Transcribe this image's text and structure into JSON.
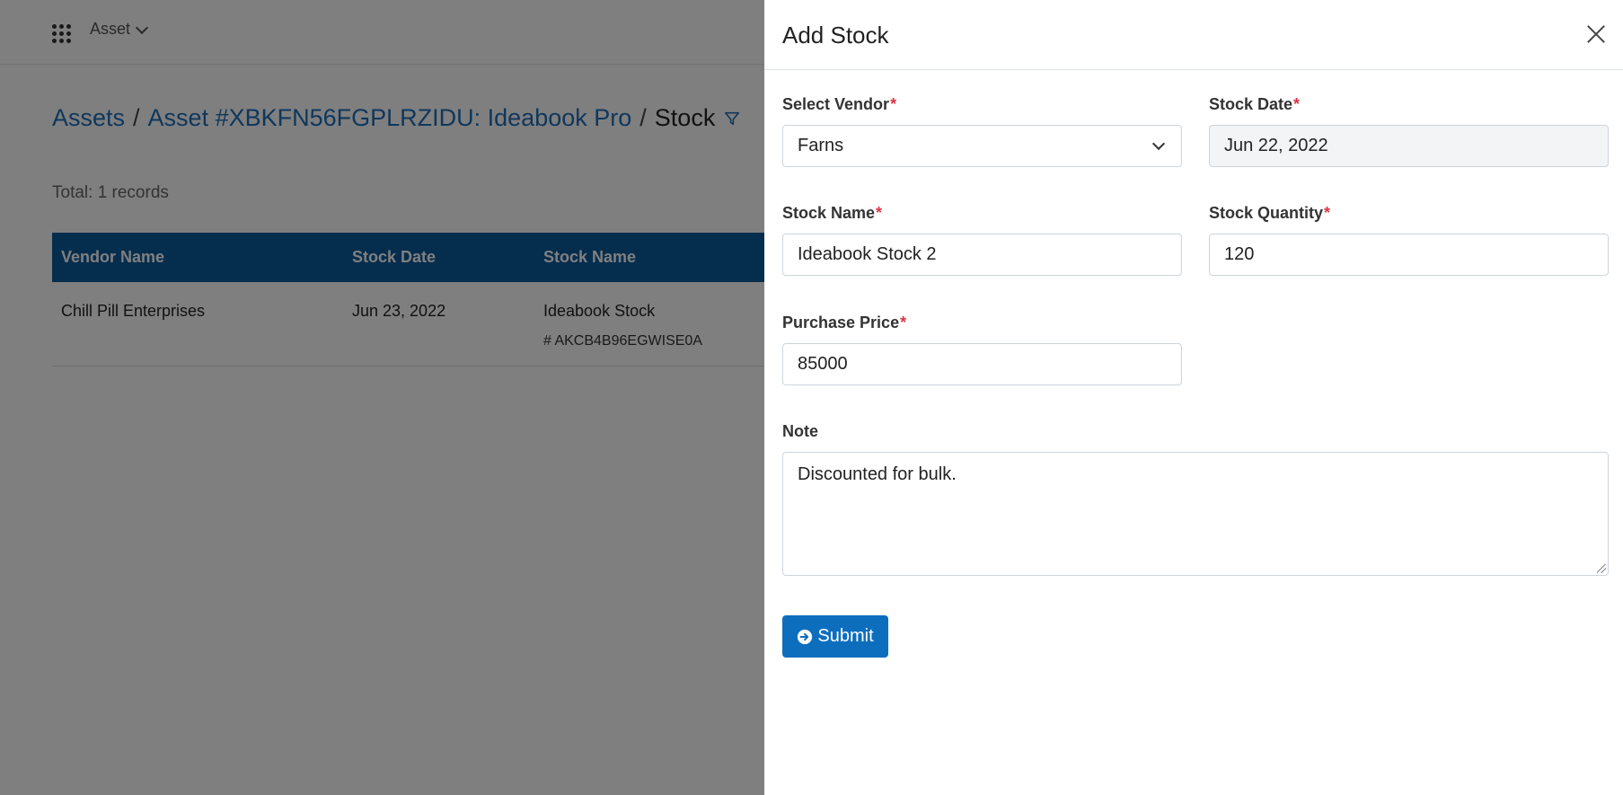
{
  "topbar": {
    "app_name": "Asset"
  },
  "breadcrumb": {
    "items": [
      "Assets",
      "Asset #XBKFN56FGPLRZIDU: Ideabook Pro",
      "Stock"
    ],
    "separator": "/"
  },
  "summary": {
    "total_text": "Total: 1 records"
  },
  "table": {
    "headers": [
      "Vendor Name",
      "Stock Date",
      "Stock Name"
    ],
    "rows": [
      {
        "vendor": "Chill Pill Enterprises",
        "date": "Jun 23, 2022",
        "stock_name": "Ideabook Stock",
        "stock_id": "# AKCB4B96EGWISE0A"
      }
    ]
  },
  "drawer": {
    "title": "Add Stock",
    "fields": {
      "vendor": {
        "label": "Select Vendor",
        "value": "Farns"
      },
      "stock_date": {
        "label": "Stock Date",
        "value": "Jun 22, 2022"
      },
      "stock_name": {
        "label": "Stock Name",
        "value": "Ideabook Stock 2"
      },
      "stock_quantity": {
        "label": "Stock Quantity",
        "value": "120"
      },
      "purchase_price": {
        "label": "Purchase Price",
        "value": "85000"
      },
      "note": {
        "label": "Note",
        "value": "Discounted for bulk."
      }
    },
    "required_mark": "*",
    "submit_label": "Submit"
  },
  "colors": {
    "primary": "#0d6ebe",
    "table_header": "#0a5a9c",
    "link": "#1f6fb8",
    "required": "#dc3545"
  }
}
